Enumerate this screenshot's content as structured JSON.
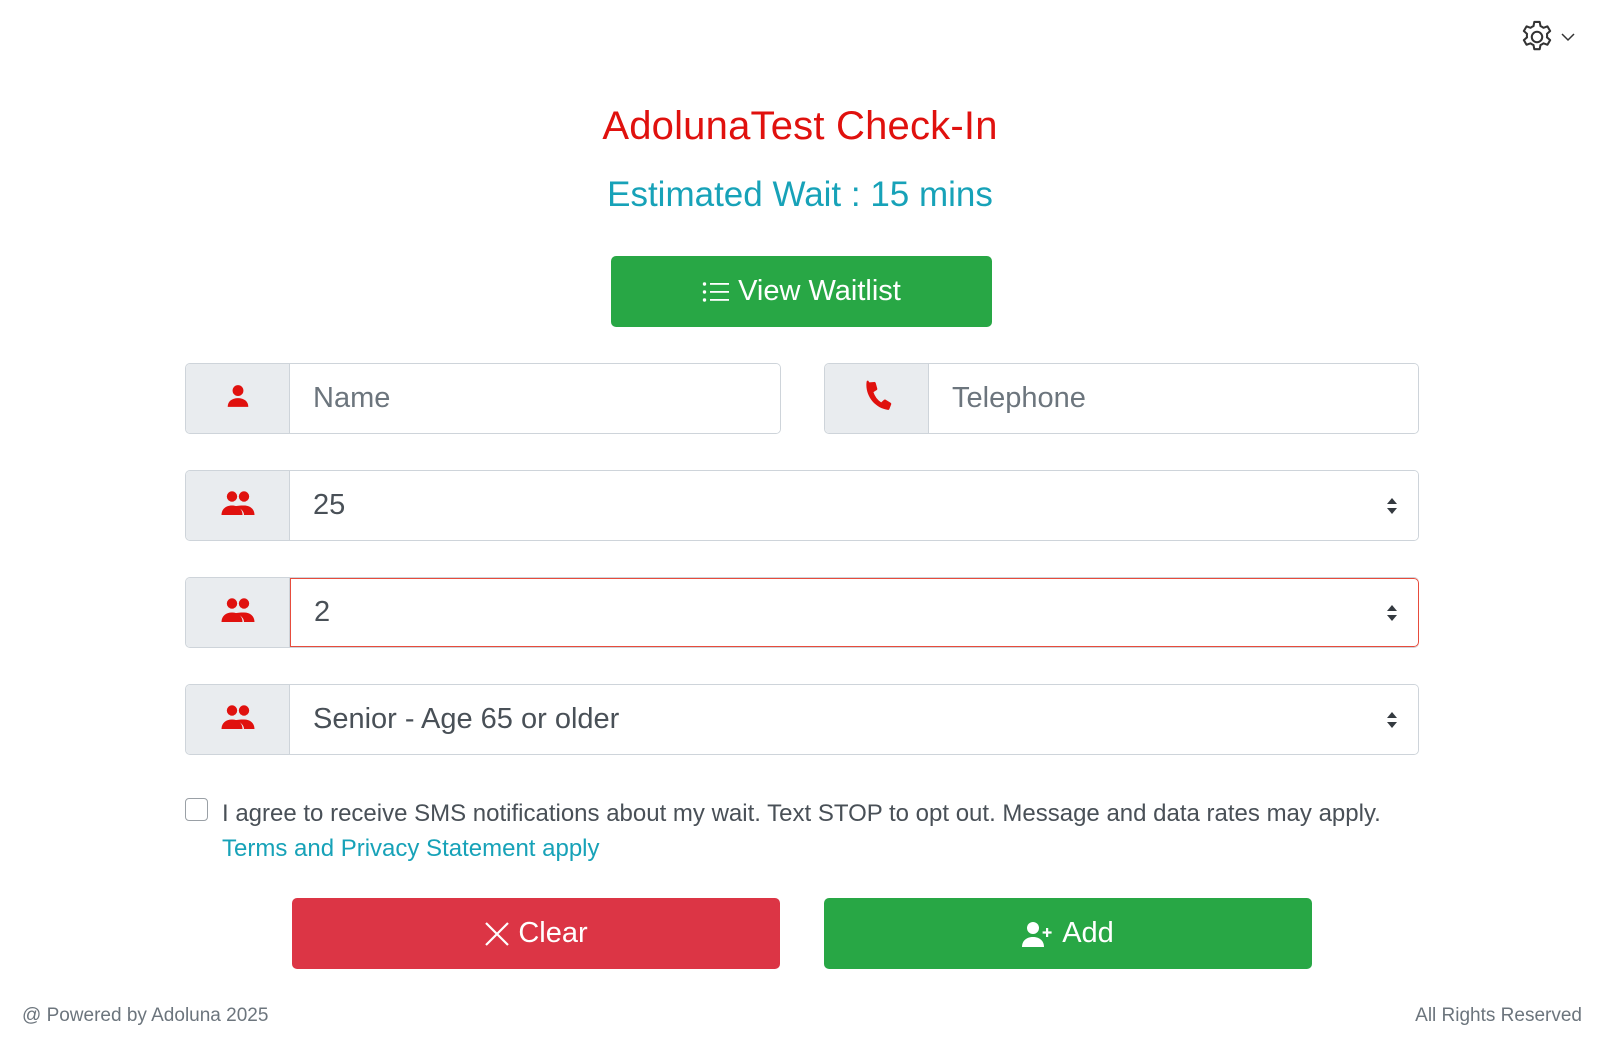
{
  "header": {
    "settings_icon": "gear-icon",
    "dropdown_icon": "chevron-down-icon"
  },
  "title": "AdolunaTest Check-In",
  "estimated_wait": "Estimated Wait : 15 mins",
  "view_waitlist_button": {
    "label": "View Waitlist",
    "icon": "list-icon"
  },
  "form": {
    "name": {
      "placeholder": "Name",
      "value": "",
      "icon": "user-icon"
    },
    "telephone": {
      "placeholder": "Telephone",
      "value": "",
      "icon": "phone-icon"
    },
    "select_1": {
      "value": "25",
      "icon": "users-icon"
    },
    "select_2": {
      "value": "2",
      "icon": "users-icon",
      "invalid": true
    },
    "select_3": {
      "value": "Senior - Age 65 or older",
      "icon": "users-icon"
    }
  },
  "consent": {
    "checked": false,
    "text": "I agree to receive SMS notifications about my wait. Text STOP to opt out. Message and data rates may apply.",
    "link_text": "Terms and Privacy Statement apply"
  },
  "actions": {
    "clear_label": "Clear",
    "add_label": "Add"
  },
  "footer": {
    "left": "@ Powered by Adoluna 2025",
    "right": "All Rights Reserved"
  },
  "colors": {
    "title": "#e0110e",
    "wait": "#17a2b8",
    "success": "#28a745",
    "danger": "#dc3545",
    "icon_red": "#e0110e",
    "link": "#17a2b8"
  }
}
